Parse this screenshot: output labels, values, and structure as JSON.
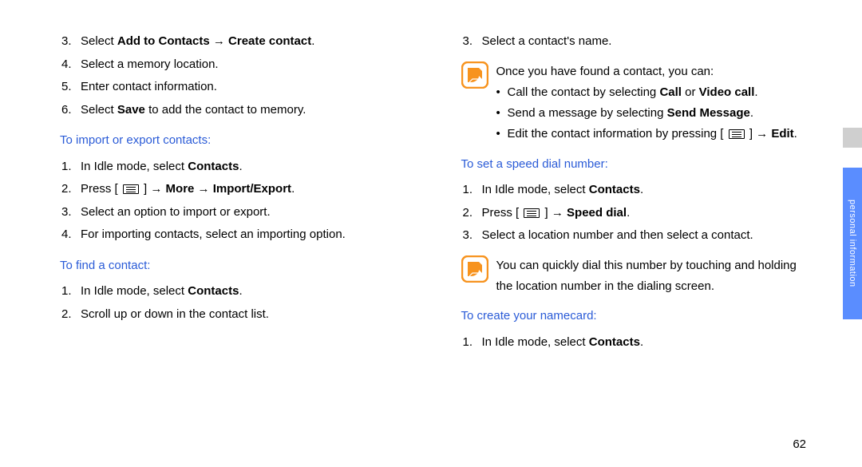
{
  "left": {
    "l3_pre": "Select ",
    "l3_b1": "Add to Contacts",
    "arrow": " → ",
    "l3_b2": "Create contact",
    "l3_post": ".",
    "l4": "Select a memory location.",
    "l5": "Enter contact information.",
    "l6_pre": "Select ",
    "l6_b": "Save",
    "l6_post": " to add the contact to memory.",
    "sub1": "To import or export contacts:",
    "s1_1_pre": "In Idle mode, select ",
    "s1_1_b": "Contacts",
    "s1_1_post": ".",
    "s1_2_pre": "Press [ ",
    "s1_2_mid1": " ] → ",
    "s1_2_b1": "More",
    "s1_2_b2": "Import/Export",
    "s1_2_post": ".",
    "s1_3": "Select an option to import or export.",
    "s1_4": "For importing contacts, select an importing option.",
    "sub2": "To find a contact:",
    "s2_1_pre": "In Idle mode, select ",
    "s2_1_b": "Contacts",
    "s2_1_post": ".",
    "s2_2": "Scroll up or down in the contact list."
  },
  "right": {
    "r3": "Select a contact's name.",
    "note1_intro": "Once you have found a contact, you can:",
    "note1_b1_pre": "Call the contact by selecting ",
    "note1_b1_b1": "Call",
    "note1_b1_mid": " or ",
    "note1_b1_b2": "Video call",
    "note1_b1_post": ".",
    "note1_b2_pre": "Send a message by selecting ",
    "note1_b2_b": "Send Message",
    "note1_b2_post": ".",
    "note1_b3_pre": "Edit the contact information by pressing [ ",
    "note1_b3_mid": " ] → ",
    "note1_b3_b": "Edit",
    "note1_b3_post": ".",
    "sub3": "To set a speed dial number:",
    "s3_1_pre": "In Idle mode, select ",
    "s3_1_b": "Contacts",
    "s3_1_post": ".",
    "s3_2_pre": "Press [ ",
    "s3_2_mid": " ] → ",
    "s3_2_b": "Speed dial",
    "s3_2_post": ".",
    "s3_3": "Select a location number and then select a contact.",
    "note2": "You can quickly dial this number by touching and holding the location number in the dialing screen.",
    "sub4": "To create your namecard:",
    "s4_1_pre": "In Idle mode, select ",
    "s4_1_b": "Contacts",
    "s4_1_post": "."
  },
  "side_label": "personal information",
  "page_number": "62",
  "nums": {
    "n1": "1.",
    "n2": "2.",
    "n3": "3.",
    "n4": "4.",
    "n5": "5.",
    "n6": "6."
  },
  "bullet": "•"
}
